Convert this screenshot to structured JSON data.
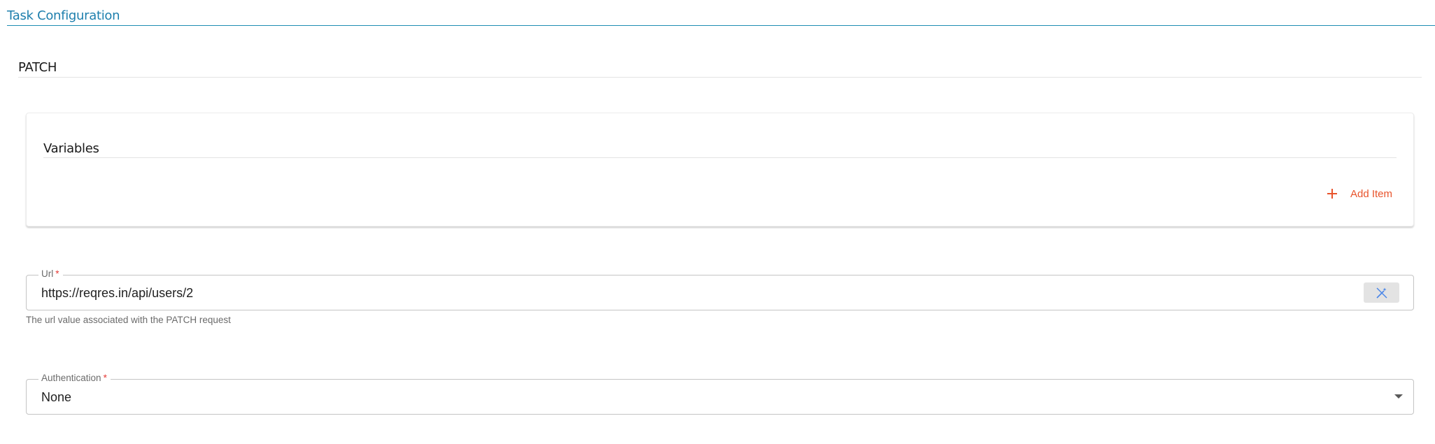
{
  "header": {
    "title": "Task Configuration"
  },
  "section": {
    "title": "PATCH"
  },
  "variables": {
    "title": "Variables",
    "add_item_label": "Add Item",
    "add_icon": "plus-icon"
  },
  "url_field": {
    "label": "Url",
    "required_marker": "*",
    "value": "https://reqres.in/api/users/2",
    "helper_text": "The url value associated with the PATCH request",
    "action_icon": "magic-wand-off-icon"
  },
  "auth_field": {
    "label": "Authentication",
    "required_marker": "*",
    "selected_value": "None",
    "dropdown_icon": "caret-down-icon"
  },
  "colors": {
    "header_accent": "#1e8db3",
    "action_accent": "#e8532b",
    "required": "#e53935",
    "wand_icon": "#4a86e8"
  }
}
